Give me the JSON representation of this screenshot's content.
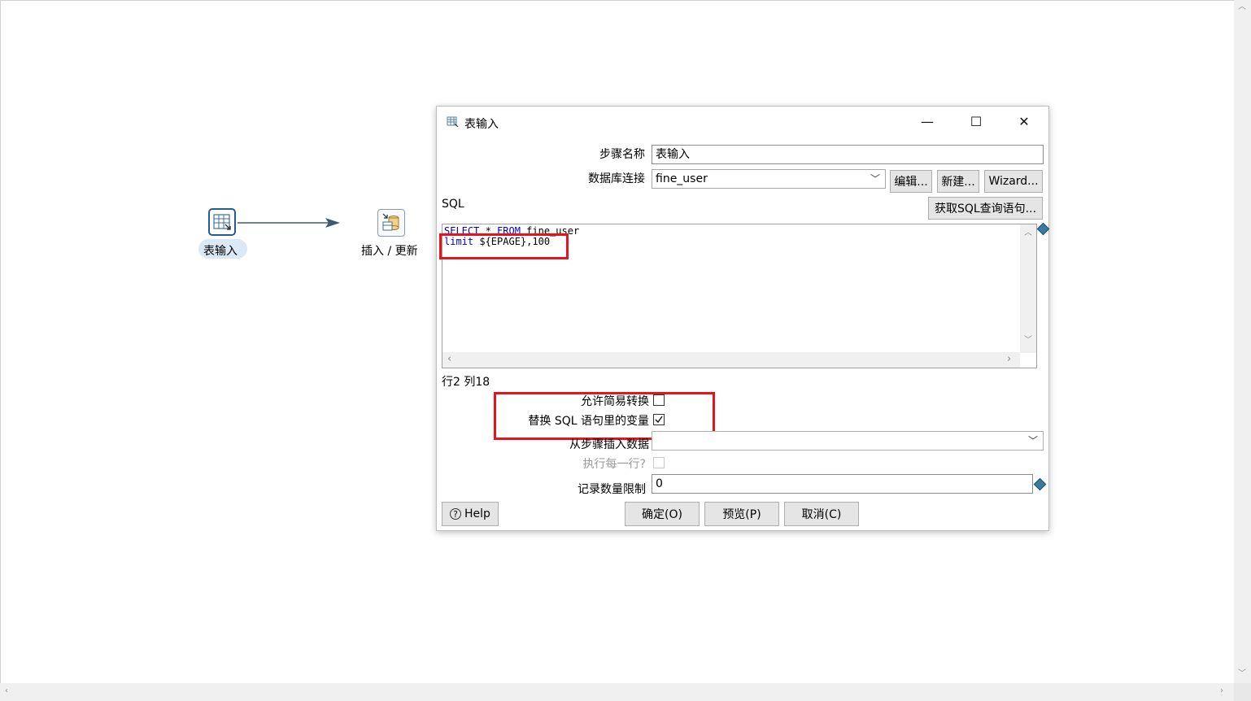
{
  "canvas": {
    "step1_label": "表输入",
    "step2_label": "插入 / 更新"
  },
  "dialog": {
    "title": "表输入",
    "window_controls": {
      "minimize": "—",
      "maximize": "☐",
      "close": "✕"
    },
    "step_name_label": "步骤名称",
    "step_name_value": "表输入",
    "connection_label": "数据库连接",
    "connection_value": "fine_user",
    "edit_button": "编辑...",
    "new_button": "新建...",
    "wizard_button": "Wizard...",
    "sql_label": "SQL",
    "get_sql_button": "获取SQL查询语句...",
    "sql_line1_kw1": "SELECT",
    "sql_line1_mid": " * ",
    "sql_line1_kw2": "FROM",
    "sql_line1_rest": " fine_user",
    "sql_line2_kw": "limit",
    "sql_line2_rest": " ${EPAGE},100",
    "cursor_position": "行2 列18",
    "lazy_conversion_label": "允许简易转换",
    "lazy_conversion_checked": false,
    "replace_vars_label": "替换 SQL 语句里的变量",
    "replace_vars_checked": true,
    "insert_from_step_label": "从步骤插入数据",
    "insert_from_step_value": "",
    "execute_each_row_label": "执行每一行?",
    "limit_label": "记录数量限制",
    "limit_value": "0",
    "help_button": "Help",
    "ok_button": "确定(O)",
    "preview_button": "预览(P)",
    "cancel_button": "取消(C)"
  },
  "colors": {
    "highlight": "#e8141d",
    "keyword": "#0000c8",
    "accent": "#1f5f94"
  }
}
